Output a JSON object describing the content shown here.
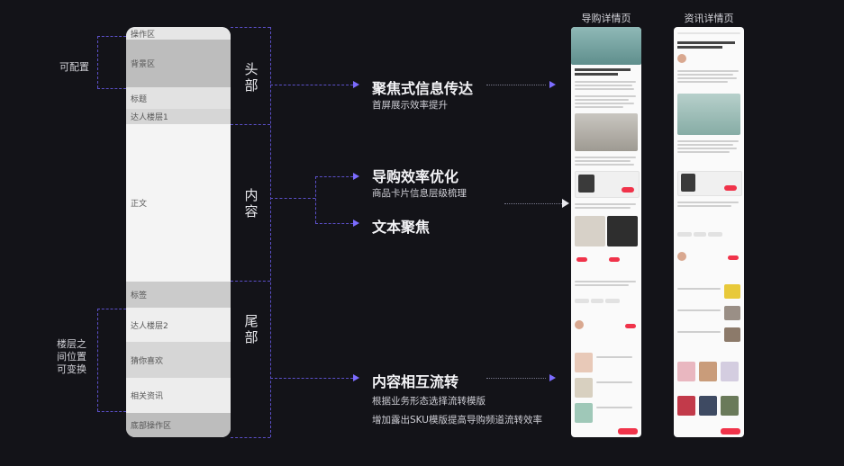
{
  "wireframe": {
    "blocks": [
      {
        "key": "op",
        "label": "操作区"
      },
      {
        "key": "bg",
        "label": "背景区"
      },
      {
        "key": "title",
        "label": "标题"
      },
      {
        "key": "author1",
        "label": "达人楼层1"
      },
      {
        "key": "body",
        "label": "正文"
      },
      {
        "key": "tag",
        "label": "标签"
      },
      {
        "key": "author2",
        "label": "达人楼层2"
      },
      {
        "key": "like",
        "label": "猜你喜欢"
      },
      {
        "key": "related",
        "label": "相关资讯"
      },
      {
        "key": "bottom",
        "label": "底部操作区"
      }
    ]
  },
  "sections": {
    "head": "头部",
    "content": "内容",
    "tail": "尾部"
  },
  "side": {
    "configurable": "可配置",
    "swappable": "楼层之\n间位置\n可变换"
  },
  "features": {
    "f1_title": "聚焦式信息传达",
    "f1_sub": "首屏展示效率提升",
    "f2_title": "导购效率优化",
    "f2_sub": "商品卡片信息层级梳理",
    "f3_title": "文本聚焦",
    "f4_title": "内容相互流转",
    "f4_sub1": "根据业务形态选择流转模版",
    "f4_sub2": "增加露出SKU模版提高导购频道流转效率"
  },
  "phones": {
    "guide_title": "导购详情页",
    "info_title": "资讯详情页"
  },
  "colors": {
    "accent": "#7c6cff",
    "dashed": "#5b4fc7",
    "background": "#131318",
    "sale_red": "#f0334a"
  }
}
